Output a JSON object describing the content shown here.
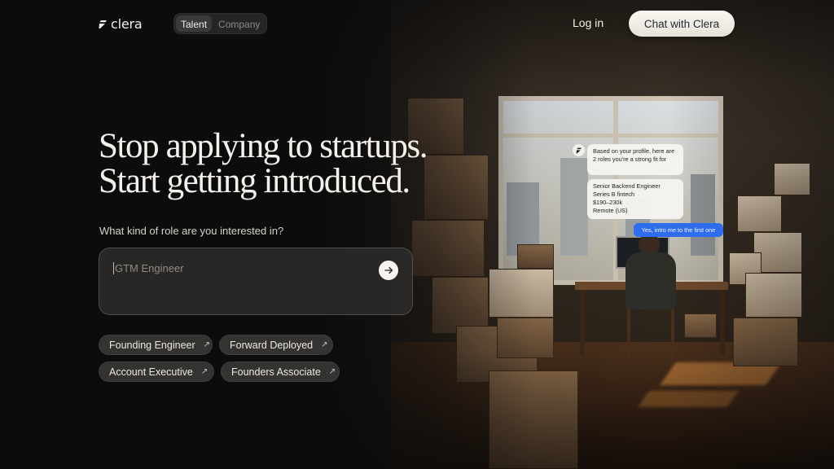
{
  "header": {
    "brand": "clera",
    "toggle": [
      "Talent",
      "Company"
    ],
    "login_label": "Log in",
    "cta_label": "Chat with Clera"
  },
  "hero": {
    "headline_line1": "Stop applying to startups.",
    "headline_line2": "Start getting introduced.",
    "question": "What kind of role are you interested in?",
    "input_placeholder": "GTM Engineer",
    "input_value": ""
  },
  "chips": [
    {
      "label": "Founding Engineer"
    },
    {
      "label": "Forward Deployed"
    },
    {
      "label": "Account Executive"
    },
    {
      "label": "Founders Associate"
    }
  ],
  "chat": {
    "assistant_message_1": "Based on your profile, here are 2 roles you're a strong fit for",
    "role_card": {
      "title": "Senior Backend Engineer",
      "company": "Series B fintech",
      "salary": "$190–230k",
      "location": "Remote (US)"
    },
    "user_reply": "Yes, intro me to the first one"
  },
  "colors": {
    "background": "#0f0f0f",
    "cta_bg": "#f3efe8",
    "cta_text": "#1f2b35",
    "user_bubble": "#2f6df0"
  },
  "icons": [
    "clera-logo-icon",
    "arrow-right-icon",
    "arrow-up-right-icon"
  ]
}
